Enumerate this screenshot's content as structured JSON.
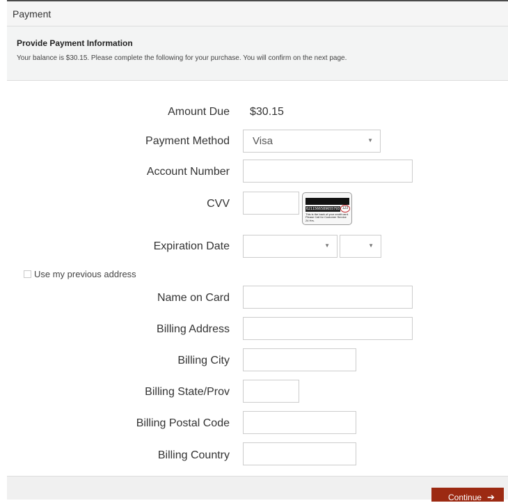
{
  "panel": {
    "title": "Payment"
  },
  "info": {
    "heading": "Provide Payment Information",
    "text": "Your balance is $30.15. Please complete the following for your purchase. You will confirm on the next page."
  },
  "form": {
    "amount_due_label": "Amount Due",
    "amount_due_value": "$30.15",
    "payment_method_label": "Payment Method",
    "payment_method_value": "Visa",
    "account_number_label": "Account Number",
    "account_number_value": "",
    "cvv_label": "CVV",
    "cvv_value": "",
    "cvv_image": {
      "card_number": "6211566589655793",
      "cvv_code": "123",
      "note": "This is the back of your credit card. Please Call for Customer Service 24 Hrs."
    },
    "expiration_label": "Expiration Date",
    "expiration_month": "",
    "expiration_year": "",
    "use_previous_address_label": "Use my previous address",
    "use_previous_address_checked": false,
    "name_on_card_label": "Name on Card",
    "billing_address_label": "Billing Address",
    "billing_city_label": "Billing City",
    "billing_state_label": "Billing State/Prov",
    "billing_postal_label": "Billing Postal Code",
    "billing_country_label": "Billing Country"
  },
  "footer": {
    "continue_label": "Continue"
  },
  "colors": {
    "accent": "#9c2a12",
    "panel_bg": "#f3f4f4",
    "border": "#cccccc"
  },
  "icons": {
    "continue": "arrow-right-icon",
    "select": "chevron-down-icon"
  }
}
